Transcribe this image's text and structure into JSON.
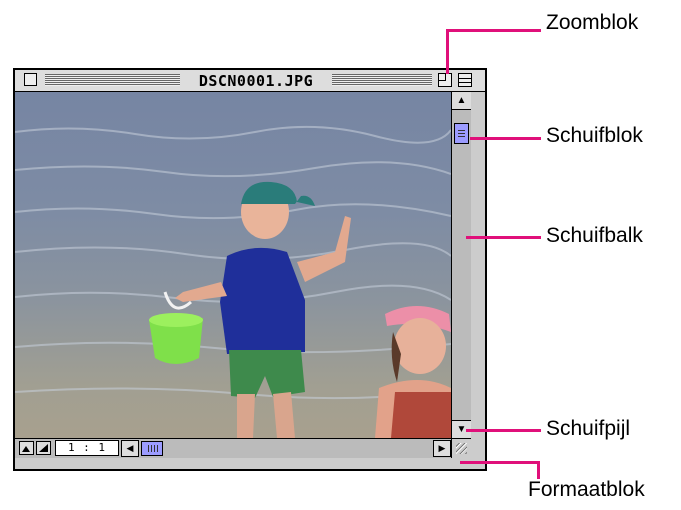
{
  "window": {
    "title": "DSCN0001.JPG",
    "zoom_level": "1 : 1"
  },
  "callouts": {
    "zoom_box": "Zoomblok",
    "scroll_thumb": "Schuifblok",
    "scroll_bar": "Schuifbalk",
    "scroll_arrow": "Schuifpijl",
    "size_box": "Formaatblok"
  },
  "photo": {
    "subject": "two children on a beach"
  },
  "colors": {
    "callout": "#e0107a",
    "scroll_thumb": "#9c9cff",
    "window_chrome": "#cccccc"
  },
  "icons": {
    "close_box": "close-box-icon",
    "zoom_box": "zoom-box-icon",
    "collapse_box": "collapse-box-icon",
    "size_box": "grow-box-icon"
  }
}
